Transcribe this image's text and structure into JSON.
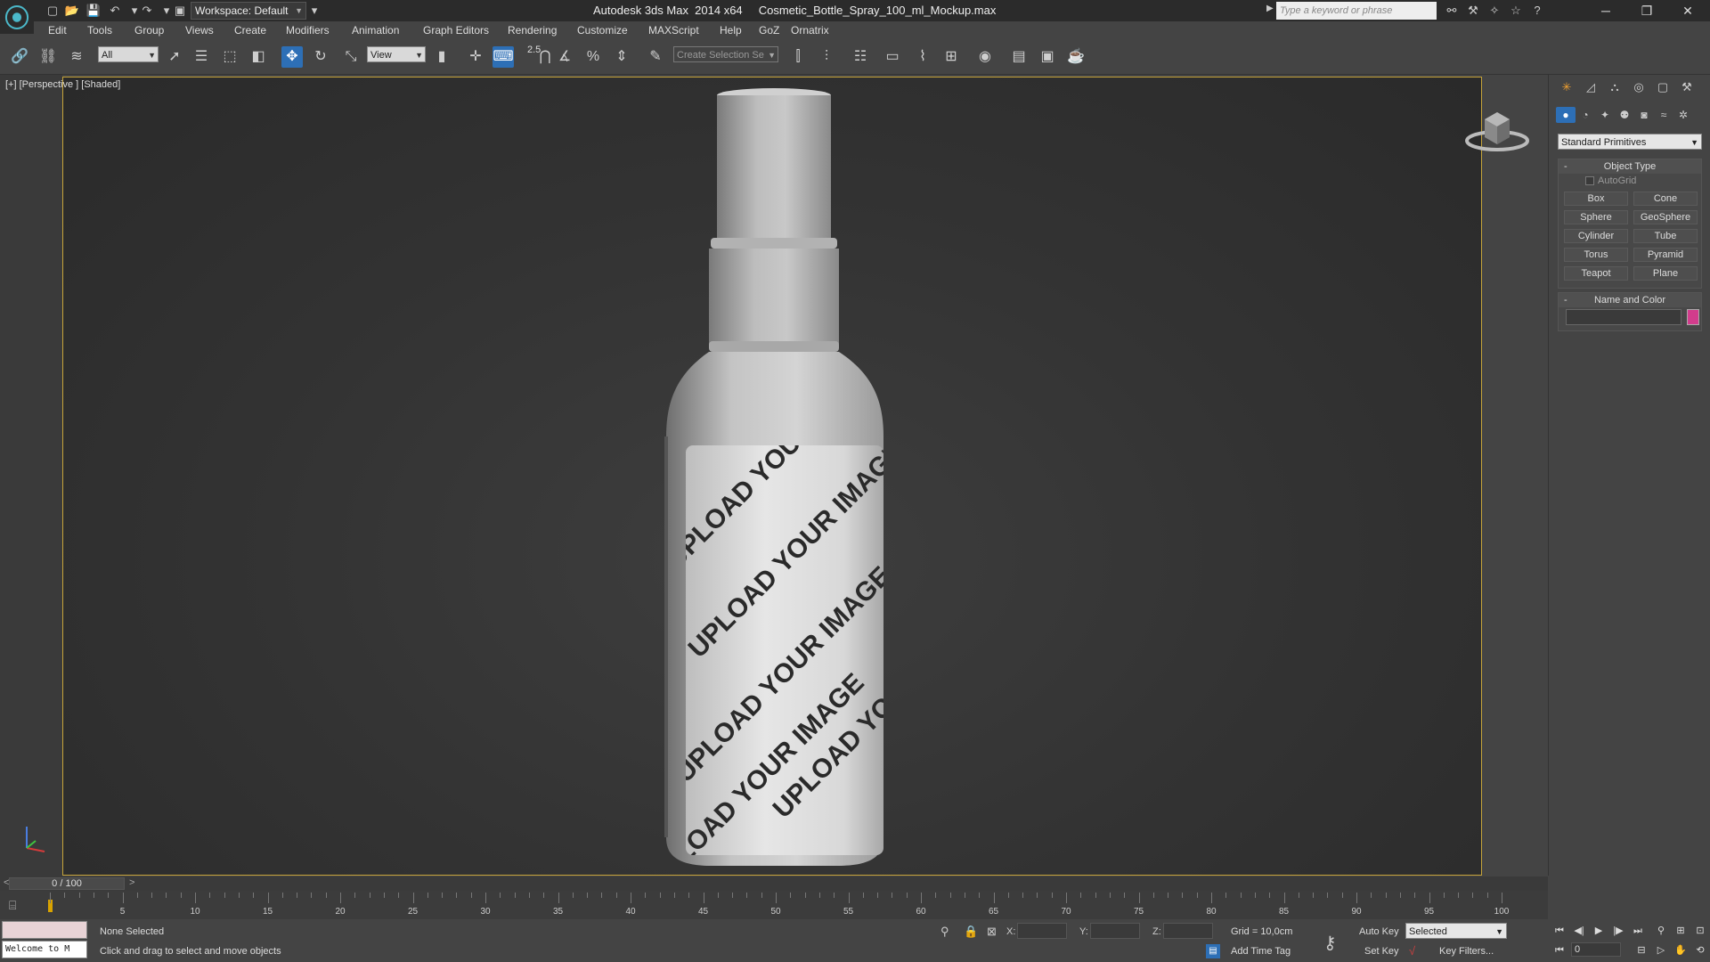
{
  "window": {
    "title": "Autodesk 3ds Max  2014 x64     Cosmetic_Bottle_Spray_100_ml_Mockup.max",
    "workspace": "Workspace: Default",
    "search_placeholder": "Type a keyword or phrase",
    "controls": {
      "minimize": "─",
      "maximize": "❐",
      "close": "✕"
    }
  },
  "menu": [
    "Edit",
    "Tools",
    "Group",
    "Views",
    "Create",
    "Modifiers",
    "Animation",
    "Graph Editors",
    "Rendering",
    "Customize",
    "MAXScript",
    "Help",
    "GoZ",
    "Ornatrix"
  ],
  "toolbar": {
    "selection_filter": "All",
    "ref_coord": "View",
    "snap_value": "2.5",
    "named_selection_placeholder": "Create Selection Se"
  },
  "viewport": {
    "label": "[+] [Perspective ] [Shaded]",
    "label_text": "UPLOAD YOUR IMAGE"
  },
  "command_panel": {
    "category": "Standard Primitives",
    "object_type_title": "Object Type",
    "autogrid": "AutoGrid",
    "primitives": [
      "Box",
      "Cone",
      "Sphere",
      "GeoSphere",
      "Cylinder",
      "Tube",
      "Torus",
      "Pyramid",
      "Teapot",
      "Plane"
    ],
    "name_color_title": "Name and Color",
    "object_color": "#d23c8c",
    "minus": "-"
  },
  "timeline": {
    "prev": "<",
    "next": ">",
    "frame": "0 / 100",
    "ticks": [
      "5",
      "10",
      "15",
      "20",
      "25",
      "30",
      "35",
      "40",
      "45",
      "50",
      "55",
      "60",
      "65",
      "70",
      "75",
      "80",
      "85",
      "90",
      "95",
      "100"
    ]
  },
  "status": {
    "maxscript_text": "Welcome to M",
    "selection": "None Selected",
    "prompt": "Click and drag to select and move objects",
    "x_label": "X:",
    "y_label": "Y:",
    "z_label": "Z:",
    "grid": "Grid = 10,0cm",
    "add_time_tag": "Add Time Tag",
    "auto_key": "Auto Key",
    "set_key": "Set Key",
    "key_mode": "Selected",
    "key_filters": "Key Filters...",
    "current_frame": "0"
  }
}
